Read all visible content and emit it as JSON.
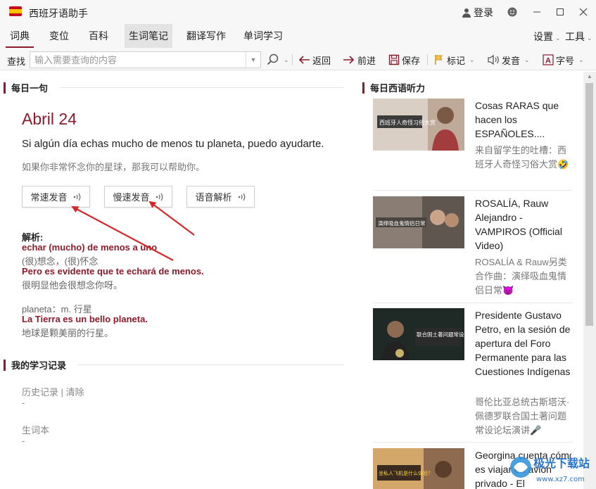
{
  "app": {
    "title": "西班牙语助手",
    "login_label": "登录"
  },
  "menu": {
    "items": [
      {
        "label": "词典"
      },
      {
        "label": "变位"
      },
      {
        "label": "百科"
      },
      {
        "label": "生词笔记"
      },
      {
        "label": "翻译写作"
      },
      {
        "label": "单词学习"
      }
    ],
    "settings_label": "设置",
    "tools_label": "工具"
  },
  "toolbar": {
    "search_label": "查找",
    "search_placeholder": "输入需要查询的内容",
    "back_label": "返回",
    "forward_label": "前进",
    "save_label": "保存",
    "mark_label": "标记",
    "pronounce_label": "发音",
    "font_label": "字号"
  },
  "daily_sentence": {
    "section_title": "每日一句",
    "date": "Abril 24",
    "sentence": "Si algún día echas mucho de menos tu planeta, puedo ayudarte.",
    "translation": "如果你非常怀念你的星球，那我可以帮助你。",
    "buttons": [
      {
        "label": "常速发音"
      },
      {
        "label": "慢速发音"
      },
      {
        "label": "语音解析"
      }
    ],
    "analysis": {
      "heading": "解析:",
      "lines": [
        {
          "text": "echar (mucho) de menos a uno",
          "style": "red"
        },
        {
          "text": "(很)想念，(很)怀念",
          "style": "gray"
        },
        {
          "text": "Pero es evidente que te echará de menos.",
          "style": "red"
        },
        {
          "text": "很明显他会很想念你呀。",
          "style": "gray"
        },
        {
          "text": "planeta：m. 行星",
          "style": "gray"
        },
        {
          "text": "La Tierra es un bello planeta.",
          "style": "red"
        },
        {
          "text": "地球是颗美丽的行星。",
          "style": "gray"
        }
      ]
    }
  },
  "study_record": {
    "section_title": "我的学习记录",
    "history_label": "历史记录 | 清除",
    "history_value": "-",
    "wordbook_label": "生词本",
    "wordbook_value": "-"
  },
  "listening": {
    "section_title": "每日西语听力",
    "videos": [
      {
        "title": "Cosas RARAS que hacen los ESPAÑOLES....",
        "subtitle": "来自留学生的吐槽：西班牙人奇怪习俗大赏🤣",
        "thumb_caption": "西班牙人奇怪习俗大赏"
      },
      {
        "title": "ROSALÍA, Rauw Alejandro - VAMPIROS (Official Video)",
        "subtitle": "ROSALÍA & Rauw另类合作曲：演绎吸血鬼情侣日常👿",
        "thumb_caption": "演绎吸血鬼情侣日常"
      },
      {
        "title": "Presidente Gustavo Petro, en la sesión de apertura del Foro Permanente para las Cuestiones Indígenas",
        "subtitle": "哥伦比亚总统古斯塔沃·佩德罗联合国土著问题常设论坛演讲🎤",
        "thumb_caption": "联合国土著问题常设论坛演讲"
      },
      {
        "title": "Georgina cuenta cómo es viajar en avión privado - El",
        "subtitle": "",
        "thumb_caption": "坐私人飞机是什么体验？"
      }
    ]
  },
  "watermark": {
    "text": "极光下载站",
    "url": "www.xz7.com"
  },
  "colors": {
    "accent": "#8b1a2b",
    "arrow": "#d62828"
  }
}
